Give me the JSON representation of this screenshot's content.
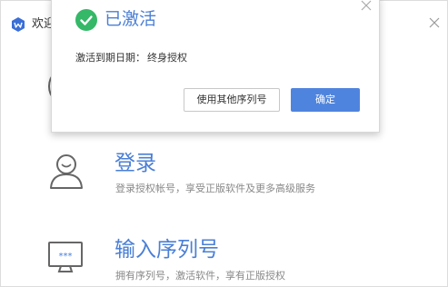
{
  "window": {
    "title": "欢迎",
    "icon": "wps-logo-icon",
    "close_icon": "close-icon"
  },
  "options": [
    {
      "icon": "user-icon",
      "title": "登录",
      "desc": "登录授权帐号，享受正版软件及更多高级服务"
    },
    {
      "icon": "serial-monitor-icon",
      "title": "输入序列号",
      "desc": "拥有序列号，激活软件，享有正版授权"
    }
  ],
  "dialog": {
    "status_icon": "check-circle-icon",
    "status_title": "已激活",
    "expire_label": "激活到期日期：",
    "expire_value": "终身授权",
    "other_serial_button": "使用其他序列号",
    "ok_button": "确定"
  },
  "colors": {
    "accent": "#4a7fd6",
    "primary_button": "#4f84de",
    "success": "#35b868"
  }
}
